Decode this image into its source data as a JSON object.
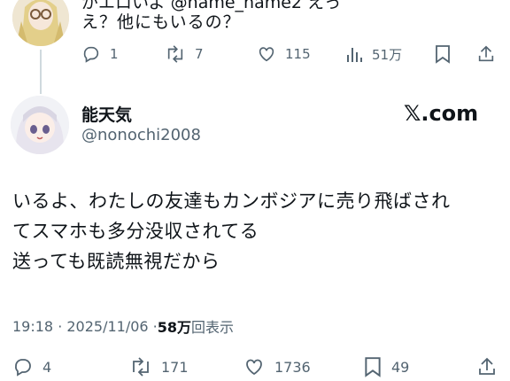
{
  "parent_tweet": {
    "top_text_partial": "がエロいよ @name_name2 えっ",
    "text": "え？他にもいるの？",
    "actions": {
      "replies": "1",
      "retweets": "7",
      "likes": "115",
      "views": "51万"
    }
  },
  "tweet": {
    "display_name": "能天気",
    "handle": "@nonochi2008",
    "watermark": "𝕏.com",
    "body_lines": [
      "いるよ、わたしの友達もカンボジアに売り飛ばされ",
      "てスマホも多分没収されてる",
      "送っても既読無視だから"
    ],
    "timestamp": "19:18 · 2025/11/06 · ",
    "views_count": "58万",
    "views_label": "回表示",
    "actions": {
      "replies": "4",
      "retweets": "171",
      "likes": "1736",
      "bookmarks": "49"
    }
  },
  "icons": [
    "reply-icon",
    "retweet-icon",
    "like-icon",
    "views-icon",
    "bookmark-icon",
    "share-icon"
  ]
}
